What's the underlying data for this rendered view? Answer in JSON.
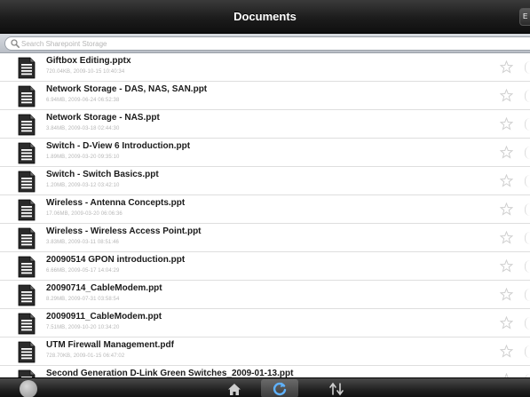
{
  "window": {
    "title": "Documents",
    "edit_label": "E"
  },
  "search": {
    "placeholder": "Search Sharepoint Storage"
  },
  "documents": [
    {
      "name": "Giftbox Editing.pptx",
      "meta": "720.04KB, 2009-10-15 10:40:34"
    },
    {
      "name": "Network Storage - DAS, NAS, SAN.ppt",
      "meta": "6.94MB, 2009-06-24 06:52:38"
    },
    {
      "name": "Network Storage - NAS.ppt",
      "meta": "3.84MB, 2009-03-18 02:44:30"
    },
    {
      "name": "Switch - D-View 6 Introduction.ppt",
      "meta": "1.89MB, 2009-03-20 09:35:10"
    },
    {
      "name": "Switch - Switch Basics.ppt",
      "meta": "1.20MB, 2009-03-12 03:42:10"
    },
    {
      "name": "Wireless - Antenna Concepts.ppt",
      "meta": "17.06MB, 2009-03-20 06:06:36"
    },
    {
      "name": "Wireless - Wireless Access Point.ppt",
      "meta": "3.83MB, 2009-03-11 08:51:46"
    },
    {
      "name": "20090514 GPON introduction.ppt",
      "meta": "6.66MB, 2009-05-17 14:04:29"
    },
    {
      "name": "20090714_CableModem.ppt",
      "meta": "8.29MB, 2009-07-31 03:58:54"
    },
    {
      "name": "20090911_CableModem.ppt",
      "meta": "7.51MB, 2009-10-20 10:34:20"
    },
    {
      "name": "UTM Firewall Management.pdf",
      "meta": "728.70KB, 2009-01-15 06:47:02"
    },
    {
      "name": "Second Generation D-Link Green Switches_2009-01-13.ppt",
      "meta": ""
    }
  ],
  "icons": {
    "document": "document-icon",
    "favorite": "star-outline-icon",
    "detail": "disclosure-icon",
    "home": "home-icon",
    "refresh": "refresh-icon",
    "sort": "sort-arrows-icon"
  },
  "colors": {
    "title_bar": "#1c1c1c",
    "refresh_accent": "#4aa3ff",
    "meta_text": "#b7b7b7"
  }
}
